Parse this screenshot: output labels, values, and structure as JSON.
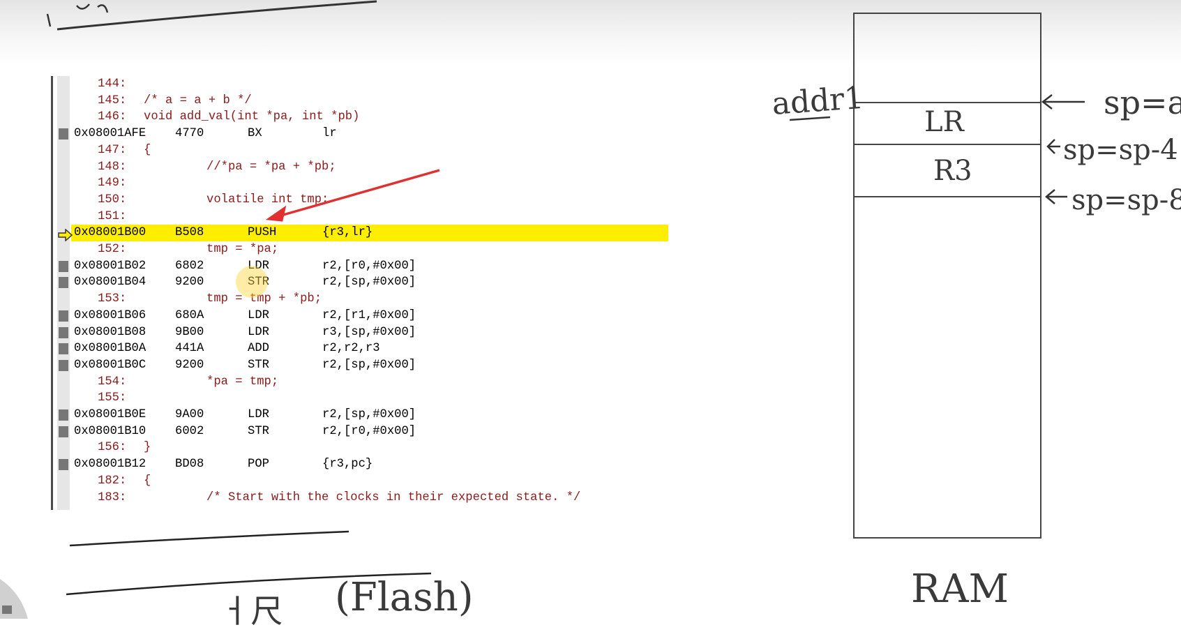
{
  "header_scribble": "",
  "disassembly": {
    "rows": [
      {
        "kind": "src",
        "line": "144:",
        "text": ""
      },
      {
        "kind": "src",
        "line": "145:",
        "text": "/* a = a + b */",
        "wide": true
      },
      {
        "kind": "src",
        "line": "146:",
        "text": "void add_val(int *pa, int *pb)",
        "wide": true
      },
      {
        "kind": "asm",
        "addr": "0x08001AFE",
        "op": "4770",
        "mn": "BX",
        "arg": "lr"
      },
      {
        "kind": "src",
        "line": "147:",
        "text": "{",
        "wide": true
      },
      {
        "kind": "src",
        "line": "148:",
        "text": "//*pa = *pa + *pb;"
      },
      {
        "kind": "src",
        "line": "149:",
        "text": ""
      },
      {
        "kind": "src",
        "line": "150:",
        "text": "volatile int tmp;"
      },
      {
        "kind": "src",
        "line": "151:",
        "text": ""
      },
      {
        "kind": "cur",
        "addr": "0x08001B00",
        "op": "B508",
        "mn": "PUSH",
        "arg": "{r3,lr}"
      },
      {
        "kind": "src",
        "line": "152:",
        "text": "tmp = *pa;"
      },
      {
        "kind": "asm",
        "addr": "0x08001B02",
        "op": "6802",
        "mn": "LDR",
        "arg": "r2,[r0,#0x00]"
      },
      {
        "kind": "asm",
        "addr": "0x08001B04",
        "op": "9200",
        "mn": "STR",
        "arg": "r2,[sp,#0x00]"
      },
      {
        "kind": "src",
        "line": "153:",
        "text": "tmp = tmp + *pb;"
      },
      {
        "kind": "asm",
        "addr": "0x08001B06",
        "op": "680A",
        "mn": "LDR",
        "arg": "r2,[r1,#0x00]"
      },
      {
        "kind": "asm",
        "addr": "0x08001B08",
        "op": "9B00",
        "mn": "LDR",
        "arg": "r3,[sp,#0x00]"
      },
      {
        "kind": "asm",
        "addr": "0x08001B0A",
        "op": "441A",
        "mn": "ADD",
        "arg": "r2,r2,r3"
      },
      {
        "kind": "asm",
        "addr": "0x08001B0C",
        "op": "9200",
        "mn": "STR",
        "arg": "r2,[sp,#0x00]"
      },
      {
        "kind": "src",
        "line": "154:",
        "text": "*pa = tmp;"
      },
      {
        "kind": "src",
        "line": "155:",
        "text": ""
      },
      {
        "kind": "asm",
        "addr": "0x08001B0E",
        "op": "9A00",
        "mn": "LDR",
        "arg": "r2,[sp,#0x00]"
      },
      {
        "kind": "asm",
        "addr": "0x08001B10",
        "op": "6002",
        "mn": "STR",
        "arg": "r2,[r0,#0x00]"
      },
      {
        "kind": "src",
        "line": "156:",
        "text": "}",
        "wide": true
      },
      {
        "kind": "asm",
        "addr": "0x08001B12",
        "op": "BD08",
        "mn": "POP",
        "arg": "{r3,pc}"
      },
      {
        "kind": "src",
        "line": "182:",
        "text": "{",
        "wide": true
      },
      {
        "kind": "src",
        "line": "183:",
        "text": "/* Start with the clocks in their expected state. */"
      }
    ]
  },
  "ram": {
    "label": "RAM",
    "cells": [
      "LR",
      "R3"
    ],
    "addr_label": "addr1",
    "sp_labels": [
      "sp=a",
      "sp=sp-4",
      "sp=sp-8"
    ]
  },
  "bottom_note": "(Flash)",
  "colors": {
    "current_line": "#ffee00",
    "source_text": "#8b1a1a",
    "arrow": "#e03030"
  }
}
